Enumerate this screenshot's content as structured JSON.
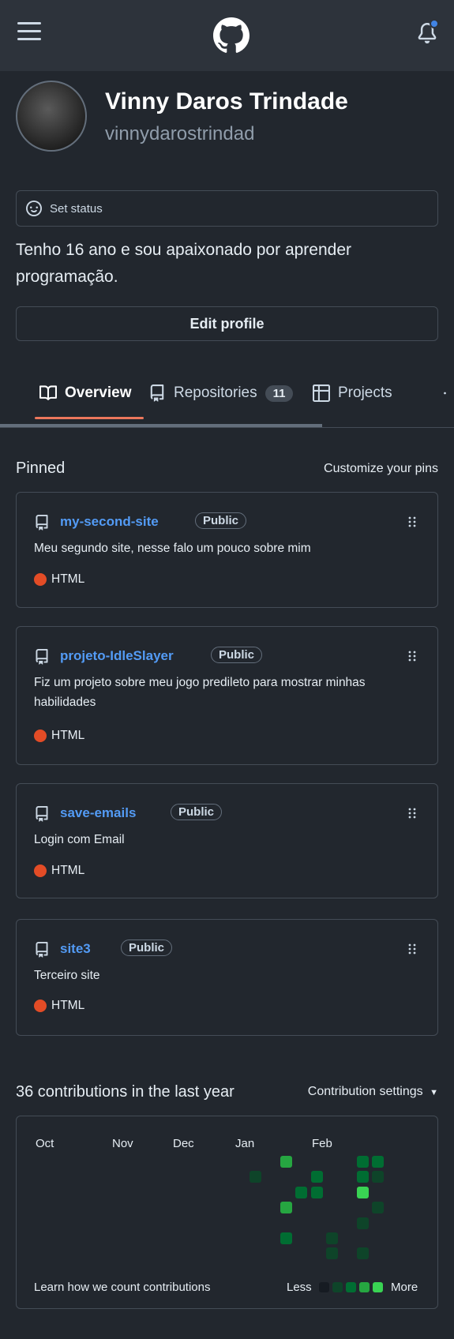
{
  "profile": {
    "full_name": "Vinny Daros Trindade",
    "username": "vinnydarostrindad",
    "set_status_label": "Set status",
    "bio": "Tenho 16 ano e sou apaixonado por aprender programação.",
    "edit_profile_label": "Edit profile"
  },
  "tabs": [
    {
      "label": "Overview",
      "icon": "book-icon",
      "active": true
    },
    {
      "label": "Repositories",
      "icon": "repo-icon",
      "counter": "11"
    },
    {
      "label": "Projects",
      "icon": "table-icon"
    }
  ],
  "pinned": {
    "title": "Pinned",
    "customize_label": "Customize your pins",
    "repos": [
      {
        "name": "my-second-site",
        "visibility": "Public",
        "description": "Meu segundo site, nesse falo um pouco sobre mim",
        "language": "HTML",
        "language_color": "#e34c26"
      },
      {
        "name": "projeto-IdleSlayer",
        "visibility": "Public",
        "description": "Fiz um projeto sobre meu jogo predileto para mostrar minhas habilidades",
        "language": "HTML",
        "language_color": "#e34c26"
      },
      {
        "name": "save-emails",
        "visibility": "Public",
        "description": "Login com Email",
        "language": "HTML",
        "language_color": "#e34c26"
      },
      {
        "name": "site3",
        "visibility": "Public",
        "description": "Terceiro site",
        "language": "HTML",
        "language_color": "#e34c26"
      }
    ]
  },
  "contributions": {
    "title": "36 contributions in the last year",
    "settings_label": "Contribution settings",
    "months": [
      "Oct",
      "Nov",
      "Dec",
      "Jan",
      "Feb"
    ],
    "learn_label": "Learn how we count contributions",
    "legend_less": "Less",
    "legend_more": "More",
    "level_colors": [
      "#0e4429",
      "#006d32",
      "#26a641",
      "#39d353"
    ]
  },
  "colors": {
    "accent_underline": "#ec775c",
    "link": "#539bf5",
    "notification_dot": "#4184e4"
  }
}
